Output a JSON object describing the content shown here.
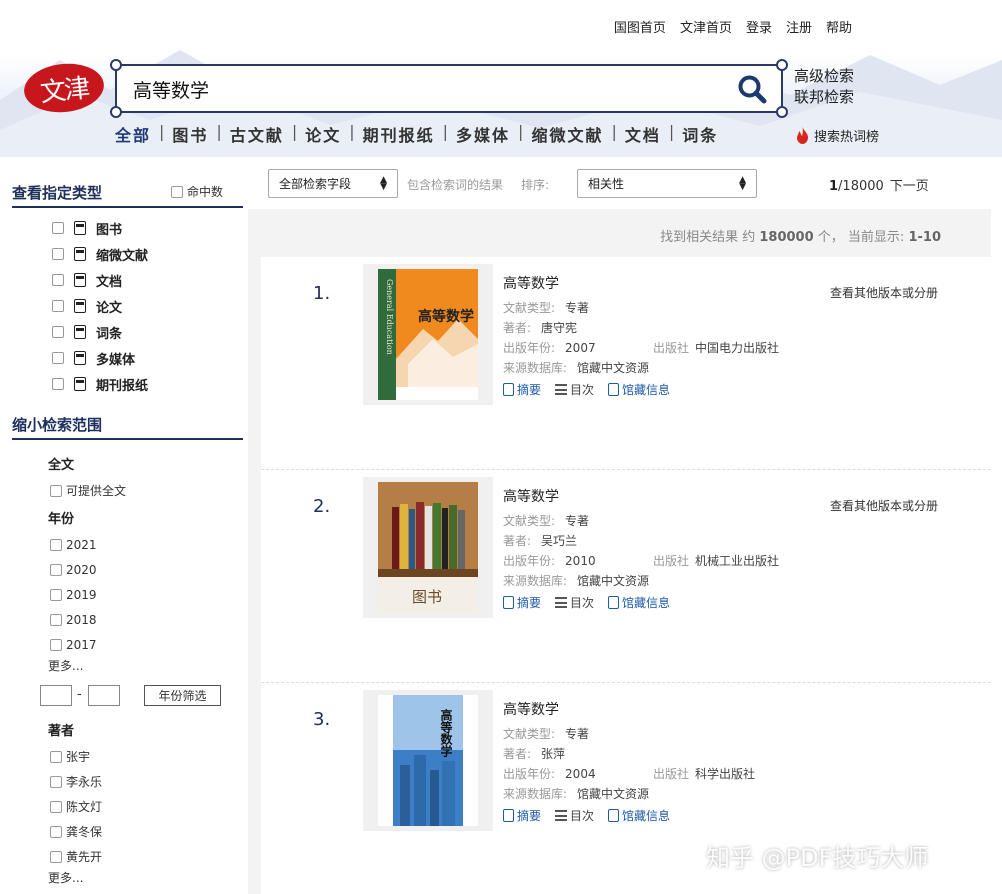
{
  "top_links": [
    "国图首页",
    "文津首页",
    "登录",
    "注册",
    "帮助"
  ],
  "logo": {
    "text": "文津"
  },
  "search": {
    "value": "高等数学"
  },
  "adv_links": [
    "高级检索",
    "联邦检索"
  ],
  "categories": [
    "全部",
    "图书",
    "古文献",
    "论文",
    "期刊报纸",
    "多媒体",
    "缩微文献",
    "文档",
    "词条"
  ],
  "hot_search": "搜索热词榜",
  "sidebar": {
    "type_title": "查看指定类型",
    "hits_label": "命中数",
    "types": [
      "图书",
      "缩微文献",
      "文档",
      "论文",
      "词条",
      "多媒体",
      "期刊报纸"
    ],
    "narrow_title": "缩小检索范围",
    "fulltext_title": "全文",
    "fulltext_option": "可提供全文",
    "year_title": "年份",
    "years": [
      "2021",
      "2020",
      "2019",
      "2018",
      "2017"
    ],
    "more": "更多...",
    "year_dash": "-",
    "year_button": "年份筛选",
    "author_title": "著者",
    "authors": [
      "张宇",
      "李永乐",
      "陈文灯",
      "龚冬保",
      "黄先开"
    ]
  },
  "toolbar": {
    "field_select": "全部检索字段",
    "include_label": "包含检索词的结果",
    "sort_label": "排序:",
    "sort_select": "相关性",
    "page_current": "1",
    "page_total": "/18000",
    "next_page": "下一页"
  },
  "found": {
    "prefix": "找到相关结果 约",
    "count": "180000",
    "mid": "个， 当前显示:",
    "range": "1-10"
  },
  "labels": {
    "type": "文献类型:",
    "author": "著者:",
    "year": "出版年份:",
    "publisher": "出版社",
    "source": "来源数据库:",
    "abstract": "摘要",
    "toc": "目次",
    "holding": "馆藏信息",
    "other_versions": "查看其他版本或分册"
  },
  "results": [
    {
      "num": "1.",
      "title": "高等数学",
      "type": "专著",
      "author": "唐守宪",
      "year": "2007",
      "publisher": "中国电力出版社",
      "source": "馆藏中文资源",
      "cover_title": "高等数学",
      "cover_spine": "General Education"
    },
    {
      "num": "2.",
      "title": "高等数学",
      "type": "专著",
      "author": "吴巧兰",
      "year": "2010",
      "publisher": "机械工业出版社",
      "source": "馆藏中文资源",
      "cover_title": "图书"
    },
    {
      "num": "3.",
      "title": "高等数学",
      "type": "专著",
      "author": "张萍",
      "year": "2004",
      "publisher": "科学出版社",
      "source": "馆藏中文资源",
      "cover_title": "高等数学"
    }
  ],
  "watermark": "知乎 @PDF技巧大师"
}
